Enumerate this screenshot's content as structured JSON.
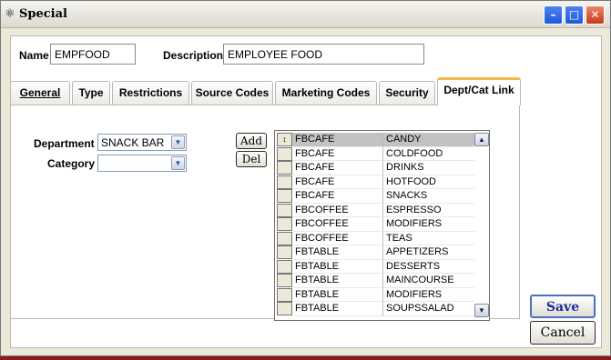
{
  "window": {
    "title": "Special"
  },
  "form": {
    "name_label": "Name",
    "name_value": "EMPFOOD",
    "description_label": "Description",
    "description_value": "EMPLOYEE FOOD"
  },
  "tabs": [
    {
      "label": "General"
    },
    {
      "label": "Type"
    },
    {
      "label": "Restrictions"
    },
    {
      "label": "Source Codes"
    },
    {
      "label": "Marketing Codes"
    },
    {
      "label": "Security"
    },
    {
      "label": "Dept/Cat Link"
    }
  ],
  "deptcat": {
    "department_label": "Department",
    "department_value": "SNACK BAR",
    "category_label": "Category",
    "category_value": "",
    "add_label": "Add",
    "del_label": "Del",
    "rows": [
      {
        "dept": "FBCAFE",
        "cat": "CANDY"
      },
      {
        "dept": "FBCAFE",
        "cat": "COLDFOOD"
      },
      {
        "dept": "FBCAFE",
        "cat": "DRINKS"
      },
      {
        "dept": "FBCAFE",
        "cat": "HOTFOOD"
      },
      {
        "dept": "FBCAFE",
        "cat": "SNACKS"
      },
      {
        "dept": "FBCOFFEE",
        "cat": "ESPRESSO"
      },
      {
        "dept": "FBCOFFEE",
        "cat": "MODIFIERS"
      },
      {
        "dept": "FBCOFFEE",
        "cat": "TEAS"
      },
      {
        "dept": "FBTABLE",
        "cat": "APPETIZERS"
      },
      {
        "dept": "FBTABLE",
        "cat": "DESSERTS"
      },
      {
        "dept": "FBTABLE",
        "cat": "MAINCOURSE"
      },
      {
        "dept": "FBTABLE",
        "cat": "MODIFIERS"
      },
      {
        "dept": "FBTABLE",
        "cat": "SOUPSSALAD"
      }
    ]
  },
  "actions": {
    "save_label": "Save",
    "cancel_label": "Cancel"
  },
  "icons": {
    "window": "app-icon",
    "minimize": "minimize-icon",
    "maximize": "maximize-icon",
    "close": "close-icon"
  }
}
